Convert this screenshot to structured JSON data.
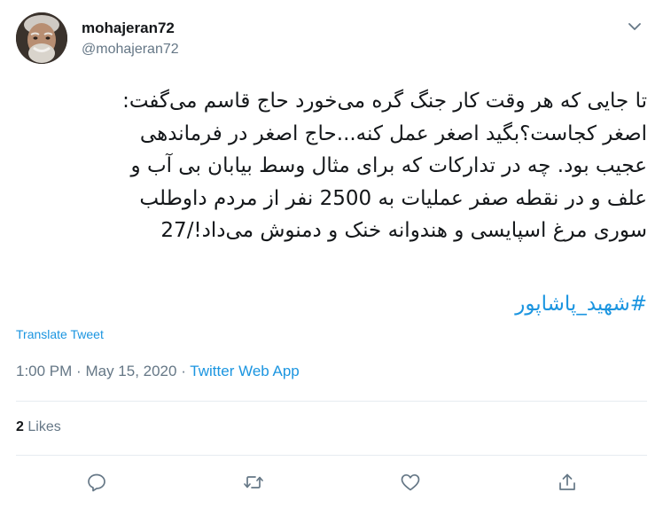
{
  "tweet": {
    "display_name": "mohajeran72",
    "username": "@mohajeran72",
    "text_lines": [
      "تا جایی که هر وقت کار جنگ گره می‌خورد حاج قاسم می‌گفت:",
      "اصغر کجاست؟بگید اصغر عمل کنه...حاج اصغر در فرماندهی",
      "عجیب بود. چه در تدارکات که برای مثال وسط بیابان بی آب و",
      "علف و در نقطه صفر عملیات به 2500 نفر از مردم داوطلب",
      "سوری مرغ اسپایسی و هندوانه خنک و دمنوش می‌داد!/27"
    ],
    "hashtag": "#شهید_پاشاپور",
    "translate_label": "Translate Tweet",
    "time": "1:00 PM",
    "date": "May 15, 2020",
    "separator": "·",
    "source": "Twitter Web App",
    "likes_count": "2",
    "likes_label": "Likes"
  },
  "icons": {
    "avatar": "profile-photo",
    "menu": "chevron-down-icon",
    "reply": "reply-icon",
    "retweet": "retweet-icon",
    "like": "heart-icon",
    "share": "share-icon"
  },
  "colors": {
    "text": "#14171a",
    "secondary": "#657786",
    "link": "#1b95e0",
    "divider": "#e6ecf0"
  }
}
